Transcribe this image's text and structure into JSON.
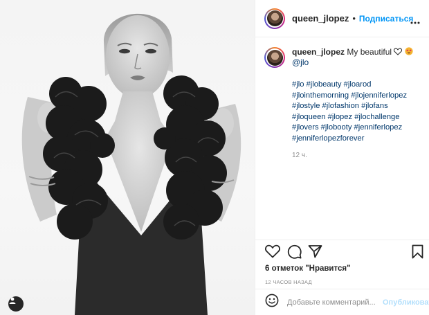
{
  "post": {
    "username": "queen_jlopez",
    "follow_label": "Подписаться",
    "separator": "•"
  },
  "caption": {
    "username": "queen_jlopez",
    "text": "My beautiful",
    "emojis": [
      "white-heart-icon",
      "star-struck-icon"
    ],
    "mention": "@jlo",
    "hashtags": "#jlo #jlobeauty #jloarod #jlointhemorning #jlojenniferlopez #jlostyle #jlofashion #jlofans #jloqueen #jlopez #jlochallenge #jlovers #jlobooty #jenniferlopez #jenniferlopezforever",
    "time": "12 ч."
  },
  "actions": {
    "icons": [
      "heart-icon",
      "comment-icon",
      "share-icon",
      "bookmark-icon"
    ],
    "likes_count": "6 отметок",
    "likes_suffix": "\"Нравится\"",
    "posted": "12 ЧАСОВ НАЗАД"
  },
  "comment": {
    "placeholder": "Добавьте комментарий...",
    "publish_label": "Опубликовать"
  },
  "colors": {
    "link": "#0095f6",
    "hashtag": "#00376b",
    "muted": "#8e8e8e",
    "publish_disabled": "#b2dffc"
  }
}
